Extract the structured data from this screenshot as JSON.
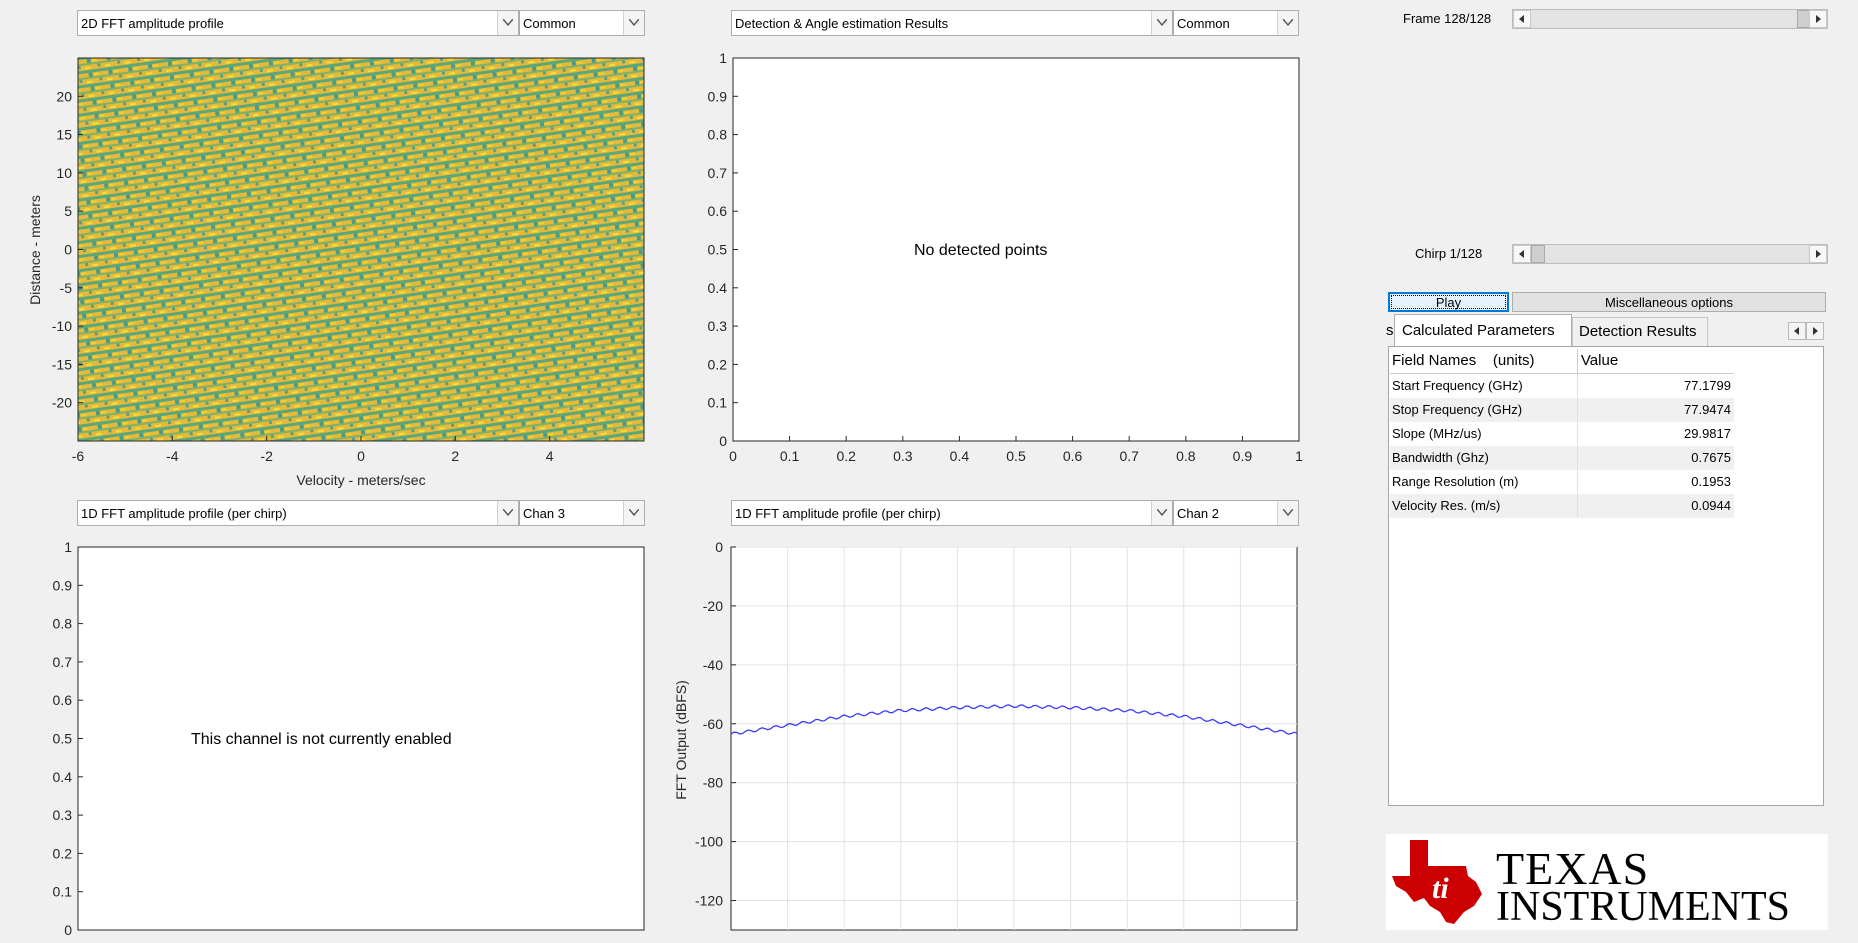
{
  "top_left": {
    "dropdown_main": "2D FFT amplitude profile",
    "dropdown_sub": "Common",
    "ylabel": "Distance - meters",
    "xlabel": "Velocity - meters/sec",
    "yticks": [
      "20",
      "15",
      "10",
      "5",
      "0",
      "-5",
      "-10",
      "-15",
      "-20"
    ],
    "xticks": [
      "-6",
      "-4",
      "-2",
      "0",
      "2",
      "4"
    ]
  },
  "top_right": {
    "dropdown_main": "Detection & Angle estimation Results",
    "dropdown_sub": "Common",
    "message": "No detected points",
    "yticks": [
      "1",
      "0.9",
      "0.8",
      "0.7",
      "0.6",
      "0.5",
      "0.4",
      "0.3",
      "0.2",
      "0.1",
      "0"
    ],
    "xticks": [
      "0",
      "0.1",
      "0.2",
      "0.3",
      "0.4",
      "0.5",
      "0.6",
      "0.7",
      "0.8",
      "0.9",
      "1"
    ]
  },
  "bottom_left": {
    "dropdown_main": "1D FFT amplitude profile (per chirp)",
    "dropdown_sub": "Chan 3",
    "message": "This channel is not currently enabled",
    "yticks": [
      "1",
      "0.9",
      "0.8",
      "0.7",
      "0.6",
      "0.5",
      "0.4",
      "0.3",
      "0.2",
      "0.1",
      "0"
    ]
  },
  "bottom_right": {
    "dropdown_main": "1D FFT amplitude profile (per chirp)",
    "dropdown_sub": "Chan 2",
    "ylabel": "FFT Output (dBFS)",
    "yticks": [
      "0",
      "-20",
      "-40",
      "-60",
      "-80",
      "-100",
      "-120"
    ]
  },
  "controls": {
    "frame_label": "Frame 128/128",
    "frame_value": 1.0,
    "chirp_label": "Chirp 1/128",
    "chirp_value": 0.0,
    "play_button": "Play",
    "misc_button": "Miscellaneous options",
    "tab_left_fragment": "s",
    "tab_calc": "Calculated Parameters",
    "tab_detect": "Detection Results"
  },
  "params_table": {
    "col_field": "Field Names    (units)",
    "col_value": "Value",
    "rows": [
      {
        "name": "Start Frequency (GHz)",
        "value": "77.1799"
      },
      {
        "name": "Stop Frequency (GHz)",
        "value": "77.9474"
      },
      {
        "name": "Slope (MHz/us)",
        "value": "29.9817"
      },
      {
        "name": "Bandwidth (Ghz)",
        "value": "0.7675"
      },
      {
        "name": "Range Resolution (m)",
        "value": "0.1953"
      },
      {
        "name": "Velocity Res. (m/s)",
        "value": "0.0944"
      }
    ]
  },
  "logo": {
    "line1": "TEXAS",
    "line2": "INSTRUMENTS",
    "color": "#cc0000"
  },
  "chart_data": [
    {
      "type": "heatmap",
      "xlabel": "Velocity - meters/sec",
      "ylabel": "Distance - meters",
      "xlim": [
        -6,
        6
      ],
      "ylim": [
        -25,
        25
      ]
    },
    {
      "type": "scatter",
      "xlim": [
        0,
        1
      ],
      "ylim": [
        0,
        1
      ],
      "points": []
    },
    {
      "type": "line",
      "ylim": [
        0,
        1
      ]
    },
    {
      "type": "line",
      "ylabel": "FFT Output (dBFS)",
      "ylim": [
        -130,
        0
      ],
      "xlim": [
        -25,
        25
      ],
      "series": [
        {
          "color": "#3b3bff",
          "x": [
            -25,
            -20,
            -15,
            -10,
            -5,
            0,
            5,
            10,
            15,
            20,
            25
          ],
          "y": [
            -63.5,
            -60.5,
            -57.5,
            -55.5,
            -54.5,
            -54,
            -54.5,
            -55.5,
            -57.5,
            -60.5,
            -63.5
          ]
        }
      ]
    }
  ]
}
